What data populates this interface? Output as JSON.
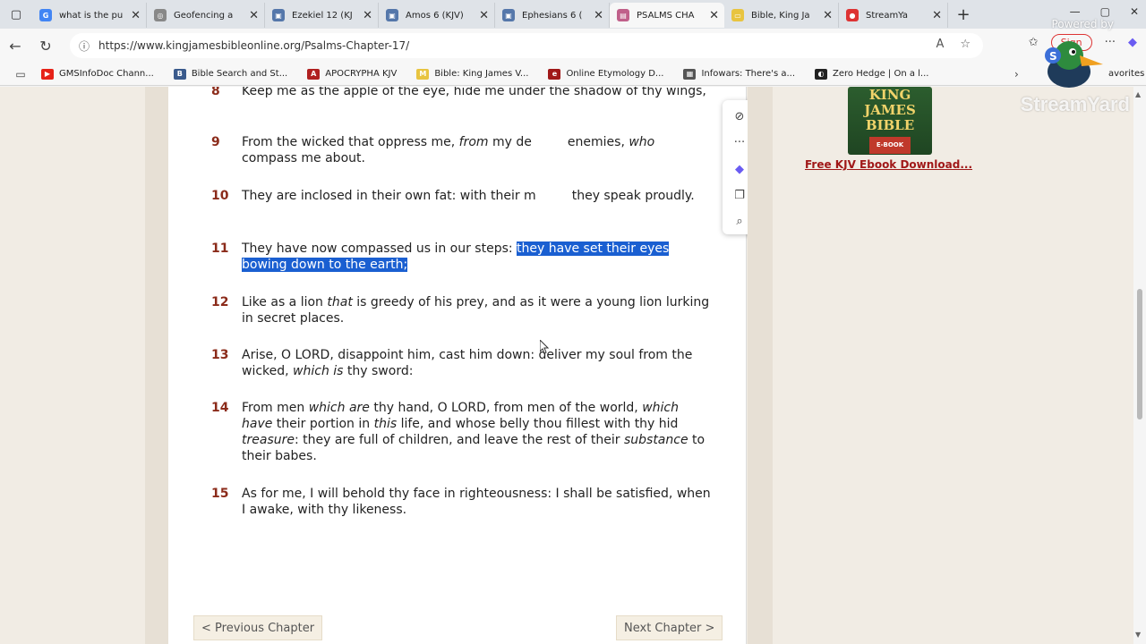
{
  "tabs": [
    {
      "title": "what is the pu",
      "color": "#4285f4",
      "glyph": "G"
    },
    {
      "title": "Geofencing a",
      "color": "#888888",
      "glyph": "◎"
    },
    {
      "title": "Ezekiel 12 (KJ",
      "color": "#5577aa",
      "glyph": "▣"
    },
    {
      "title": "Amos 6 (KJV)",
      "color": "#5577aa",
      "glyph": "▣"
    },
    {
      "title": "Ephesians 6 (",
      "color": "#5577aa",
      "glyph": "▣"
    },
    {
      "title": "PSALMS CHA",
      "color": "#c0608a",
      "glyph": "▤"
    },
    {
      "title": "Bible, King Ja",
      "color": "#e8c440",
      "glyph": "▭"
    },
    {
      "title": "StreamYa",
      "color": "#d33",
      "glyph": "●"
    }
  ],
  "url": "https://www.kingjamesbibleonline.org/Psalms-Chapter-17/",
  "signin_label": "Sign",
  "bookmarks": [
    {
      "label": "GMSInfoDoc Chann...",
      "color": "#e62117",
      "glyph": "▶"
    },
    {
      "label": "Bible Search and St...",
      "color": "#3a5a8c",
      "glyph": "B"
    },
    {
      "label": "APOCRYPHA KJV",
      "color": "#b02020",
      "glyph": "A"
    },
    {
      "label": "Bible: King James V...",
      "color": "#e8c440",
      "glyph": "M"
    },
    {
      "label": "Online Etymology D...",
      "color": "#a01818",
      "glyph": "e"
    },
    {
      "label": "Infowars: There's a...",
      "color": "#555555",
      "glyph": "▦"
    },
    {
      "label": "Zero Hedge | On a l...",
      "color": "#222222",
      "glyph": "◐"
    }
  ],
  "favorites_label": "avorites",
  "verses": [
    {
      "num": "8",
      "html": "Keep me as the apple of the eye, hide me under the shadow of thy wings,"
    },
    {
      "num": "9",
      "html": "From the wicked that oppress me, <i>from</i> my de&nbsp;&nbsp;&nbsp;&nbsp;&nbsp;&nbsp;&nbsp;&nbsp; enemies, <i>who</i> compass me about."
    },
    {
      "num": "10",
      "html": "They are inclosed in their own fat: with their m&nbsp;&nbsp;&nbsp;&nbsp;&nbsp;&nbsp;&nbsp;&nbsp; they speak proudly."
    },
    {
      "num": "11",
      "html": "They have now compassed us in our steps: <span class=\"sel\">they have set their eyes bowing down to the earth;</span>"
    },
    {
      "num": "12",
      "html": "Like as a lion <i>that</i> is greedy of his prey, and as it were a young lion lurking in secret places."
    },
    {
      "num": "13",
      "html": "Arise, O LORD, disappoint him, cast him down: deliver my soul from the wicked, <i>which is</i> thy sword:"
    },
    {
      "num": "14",
      "html": "From men <i>which are</i> thy hand, O LORD, from men of the world, <i>which have</i> their portion in <i>this</i> life, and whose belly thou fillest with thy hid <i>treasure</i>: they are full of children, and leave the rest of their <i>substance</i> to their babes."
    },
    {
      "num": "15",
      "html": "As for me, I will behold thy face in righteousness: I shall be satisfied, when I awake, with thy likeness."
    }
  ],
  "prev_chapter": "< Previous Chapter",
  "next_chapter": "Next Chapter >",
  "ad": {
    "line1": "KING",
    "line2": "JAMES",
    "line3": "BIBLE",
    "badge": "E-BOOK",
    "link": "Free KJV Ebook Download..."
  },
  "watermark": "StreamYard",
  "powered_by": "Powered by",
  "colors": {
    "verse_number": "#8b2b1a",
    "selection": "#1a5fd1",
    "ad_link": "#a01818"
  }
}
